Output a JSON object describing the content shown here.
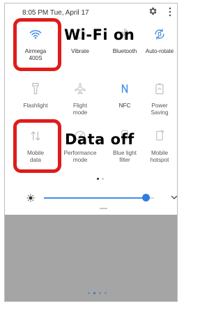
{
  "status_bar": {
    "time_date": "8:05 PM  Tue, April 17"
  },
  "tiles_row1": [
    {
      "label": "Airmega\n400S",
      "icon": "wifi-icon",
      "active": true
    },
    {
      "label": "Vibrate",
      "icon": "vibrate-icon",
      "active": false
    },
    {
      "label": "Bluetooth",
      "icon": "bluetooth-icon",
      "active": false
    },
    {
      "label": "Auto-rotate",
      "icon": "auto-rotate-icon",
      "active": true
    }
  ],
  "tiles_row2": [
    {
      "label": "Flashlight",
      "icon": "flashlight-icon",
      "active": false
    },
    {
      "label": "Flight\nmode",
      "icon": "airplane-icon",
      "active": false
    },
    {
      "label": "NFC",
      "icon": "nfc-icon",
      "active": true
    },
    {
      "label": "Power\nSaving",
      "icon": "battery-icon",
      "active": false
    }
  ],
  "tiles_row3": [
    {
      "label": "Mobile\ndata",
      "icon": "mobile-data-icon",
      "active": false
    },
    {
      "label": "Performance\nmode",
      "icon": "performance-icon",
      "active": false
    },
    {
      "label": "Blue light\nfilter",
      "icon": "blue-light-icon",
      "active": false
    },
    {
      "label": "Mobile\nhotspot",
      "icon": "hotspot-icon",
      "active": false
    }
  ],
  "brightness": {
    "level_fraction": 0.93
  },
  "annotations": {
    "wifi": "Wi-Fi on",
    "data": "Data off"
  },
  "colors": {
    "accent": "#3f8de8",
    "highlight": "#e01b1b",
    "home_area": "#a5a5a5"
  }
}
